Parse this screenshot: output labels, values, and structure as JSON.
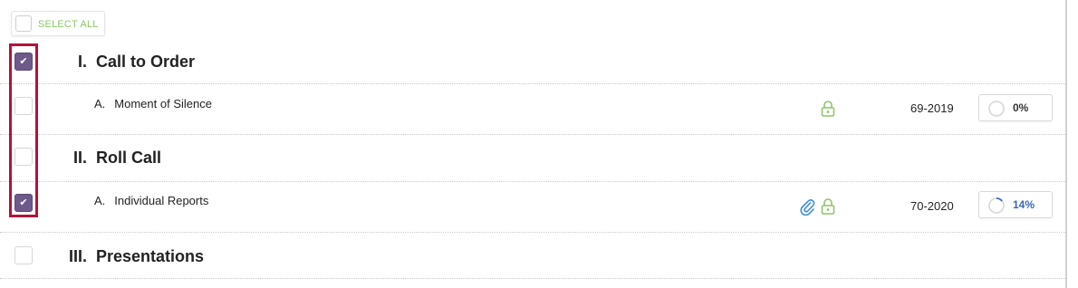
{
  "toolbar": {
    "select_all_label": "SELECT ALL"
  },
  "agenda": [
    {
      "kind": "section",
      "number": "I.",
      "title": "Call to Order",
      "checked": true
    },
    {
      "kind": "item",
      "number": "A.",
      "title": "Moment of Silence",
      "checked": false,
      "icons": [
        "lock-icon"
      ],
      "code": "69-2019",
      "progress": "0%",
      "progress_value": 0
    },
    {
      "kind": "section",
      "number": "II.",
      "title": "Roll Call",
      "checked": false
    },
    {
      "kind": "item",
      "number": "A.",
      "title": "Individual Reports",
      "checked": true,
      "icons": [
        "paperclip-icon",
        "lock-icon"
      ],
      "code": "70-2020",
      "progress": "14%",
      "progress_value": 0.14
    },
    {
      "kind": "section",
      "number": "III.",
      "title": "Presentations",
      "checked": false
    }
  ],
  "colors": {
    "checkbox_checked": "#6e5a8a",
    "lock_icon": "#8fc46a",
    "attachment_icon": "#3b8ed6",
    "progress_active": "#3a66b8",
    "highlight_border": "#b3123a"
  }
}
